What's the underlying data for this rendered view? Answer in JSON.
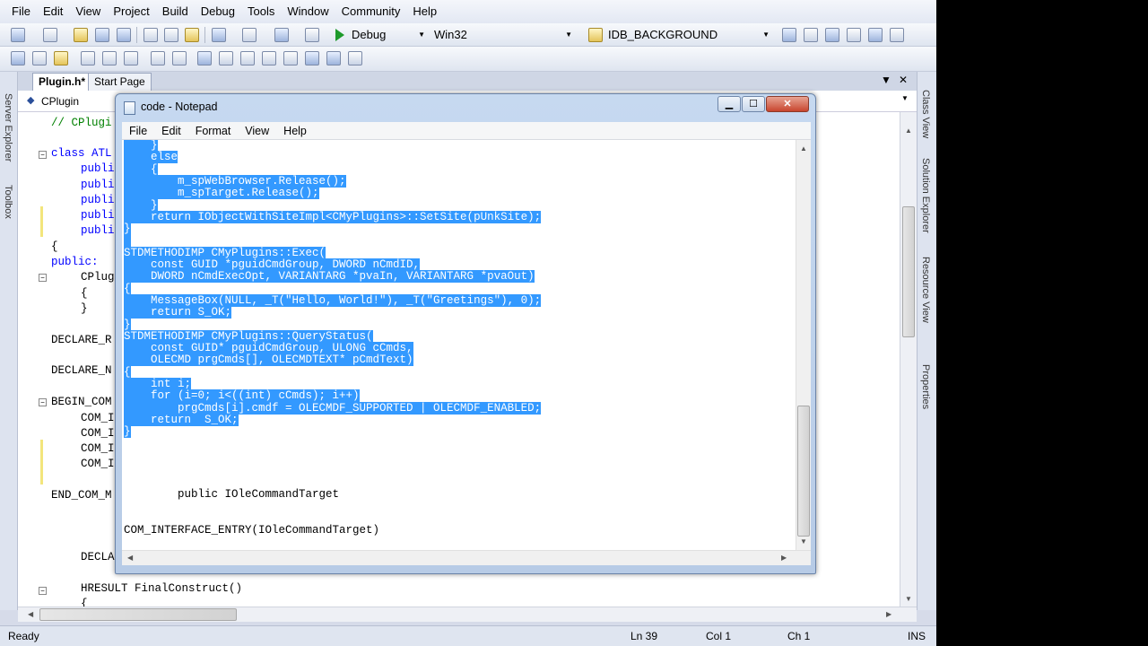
{
  "ide": {
    "menu": [
      "File",
      "Edit",
      "View",
      "Project",
      "Build",
      "Debug",
      "Tools",
      "Window",
      "Community",
      "Help"
    ],
    "config": "Debug",
    "platform": "Win32",
    "resource": "IDB_BACKGROUND",
    "tabs": [
      "Plugin.h*",
      "Start Page"
    ],
    "class_combo": "CPlugin",
    "left_panels": [
      "Server Explorer",
      "Toolbox"
    ],
    "right_panels": [
      "Class View",
      "Solution Explorer",
      "Resource View",
      "Properties"
    ],
    "code_lines": [
      "// CPlugi",
      "class ATL",
      "publi",
      "publi",
      "publi",
      "publi",
      "publi",
      "{",
      "public:",
      "CPlug",
      "{",
      "}",
      "DECLARE_R",
      "DECLARE_N",
      "BEGIN_COM",
      "COM_I",
      "COM_I",
      "COM_I",
      "COM_I",
      "END_COM_M",
      "DECLA",
      "HRESULT FinalConstruct()",
      "{"
    ],
    "status": {
      "ready": "Ready",
      "ln": "Ln 39",
      "col": "Col 1",
      "ch": "Ch 1",
      "ins": "INS"
    }
  },
  "notepad": {
    "title": "code - Notepad",
    "menu": [
      "File",
      "Edit",
      "Format",
      "View",
      "Help"
    ],
    "selected_lines": [
      "    }",
      "    else",
      "    {",
      "        m_spWebBrowser.Release();",
      "        m_spTarget.Release();",
      "    }",
      "    return IObjectWithSiteImpl<CMyPlugins>::SetSite(pUnkSite);",
      "}",
      "",
      "STDMETHODIMP CMyPlugins::Exec(",
      "    const GUID *pguidCmdGroup, DWORD nCmdID,",
      "    DWORD nCmdExecOpt, VARIANTARG *pvaIn, VARIANTARG *pvaOut)",
      "{",
      "    MessageBox(NULL, _T(\"Hello, World!\"), _T(\"Greetings\"), 0);",
      "    return S_OK;",
      "}",
      "STDMETHODIMP CMyPlugins::QueryStatus(",
      "    const GUID* pguidCmdGroup, ULONG cCmds,",
      "    OLECMD prgCmds[], OLECMDTEXT* pCmdText)",
      "{",
      "    int i;",
      "    for (i=0; i<((int) cCmds); i++)",
      "        prgCmds[i].cmdf = OLECMDF_SUPPORTED | OLECMDF_ENABLED;",
      "    return  S_OK;",
      "}"
    ],
    "plain_lines": [
      "        public IOleCommandTarget",
      "COM_INTERFACE_ENTRY(IOleCommandTarget)"
    ]
  }
}
